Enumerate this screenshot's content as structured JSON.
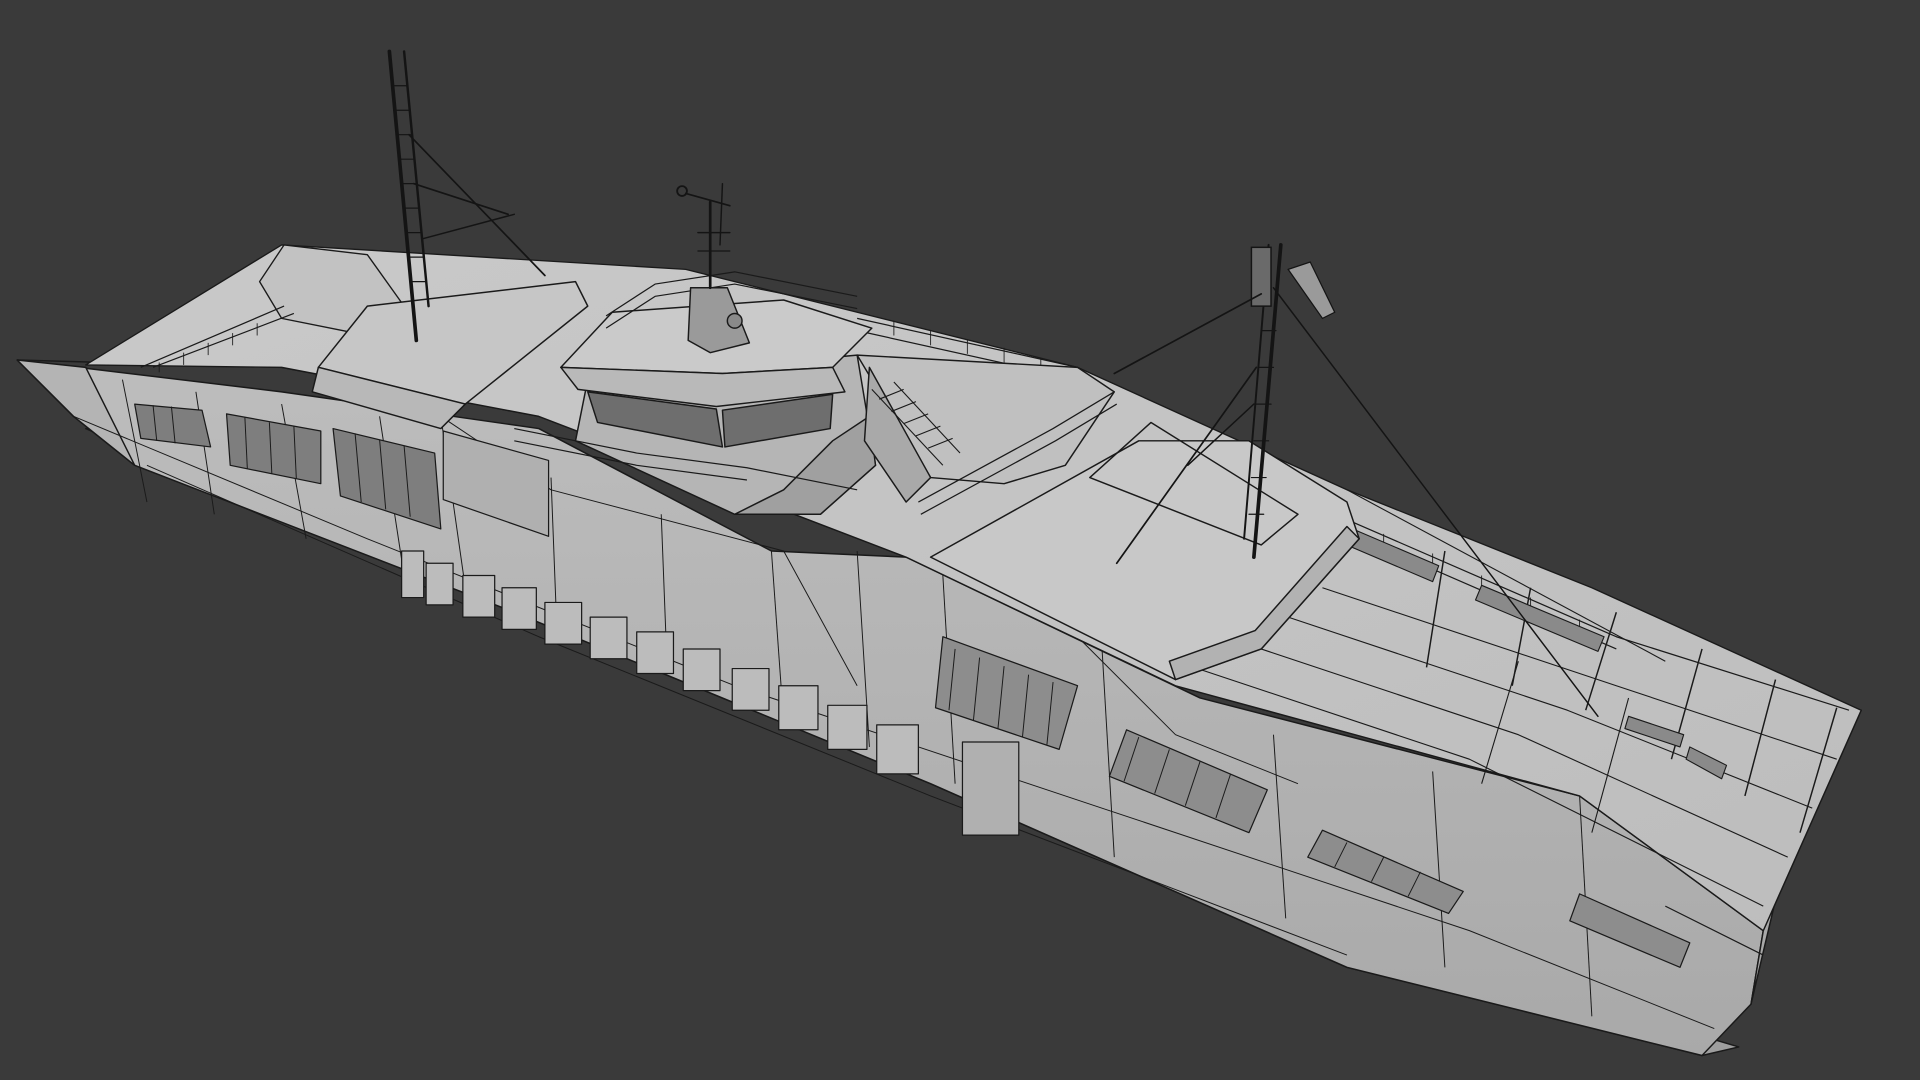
{
  "viewport": {
    "background_color": "#3a3a3a",
    "model": {
      "subject": "ferry-wireframe",
      "shade_color": "#c4c4c4",
      "edge_color": "#1a1a1a"
    }
  }
}
